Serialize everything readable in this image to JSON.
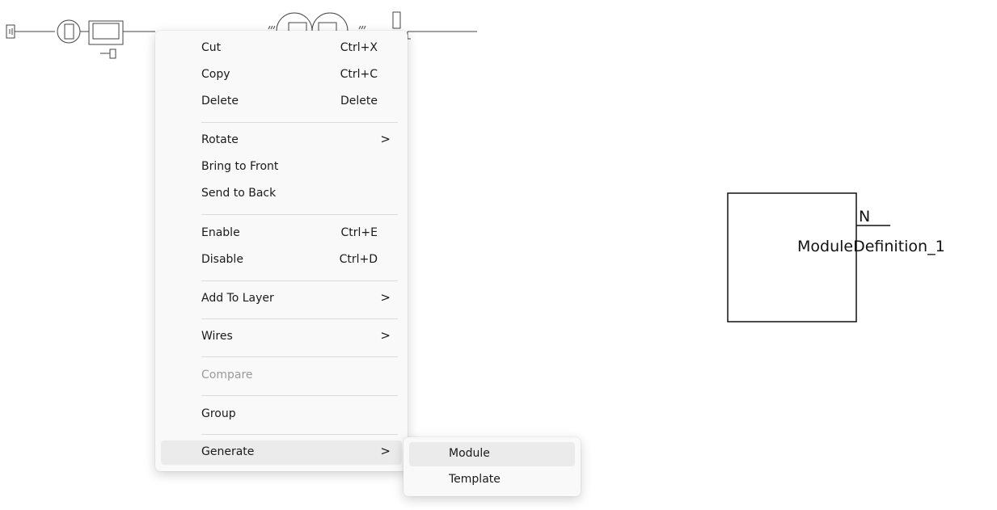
{
  "context_menu": {
    "items": [
      {
        "label": "Cut",
        "shortcut": "Ctrl+X"
      },
      {
        "label": "Copy",
        "shortcut": "Ctrl+C"
      },
      {
        "label": "Delete",
        "shortcut": "Delete"
      },
      {
        "label": "Rotate",
        "submenu_arrow": ">"
      },
      {
        "label": "Bring to Front"
      },
      {
        "label": "Send to Back"
      },
      {
        "label": "Enable",
        "shortcut": "Ctrl+E"
      },
      {
        "label": "Disable",
        "shortcut": "Ctrl+D"
      },
      {
        "label": "Add To Layer",
        "submenu_arrow": ">"
      },
      {
        "label": "Wires",
        "submenu_arrow": ">"
      },
      {
        "label": "Compare",
        "disabled": true
      },
      {
        "label": "Group"
      },
      {
        "label": "Generate",
        "submenu_arrow": ">",
        "highlighted": true
      }
    ]
  },
  "generate_submenu": {
    "items": [
      {
        "label": "Module",
        "highlighted": true
      },
      {
        "label": "Template"
      }
    ]
  },
  "canvas": {
    "module_block": {
      "port_label": "N",
      "name": "ModuleDefinition_1"
    },
    "wire_color": "#333333"
  }
}
